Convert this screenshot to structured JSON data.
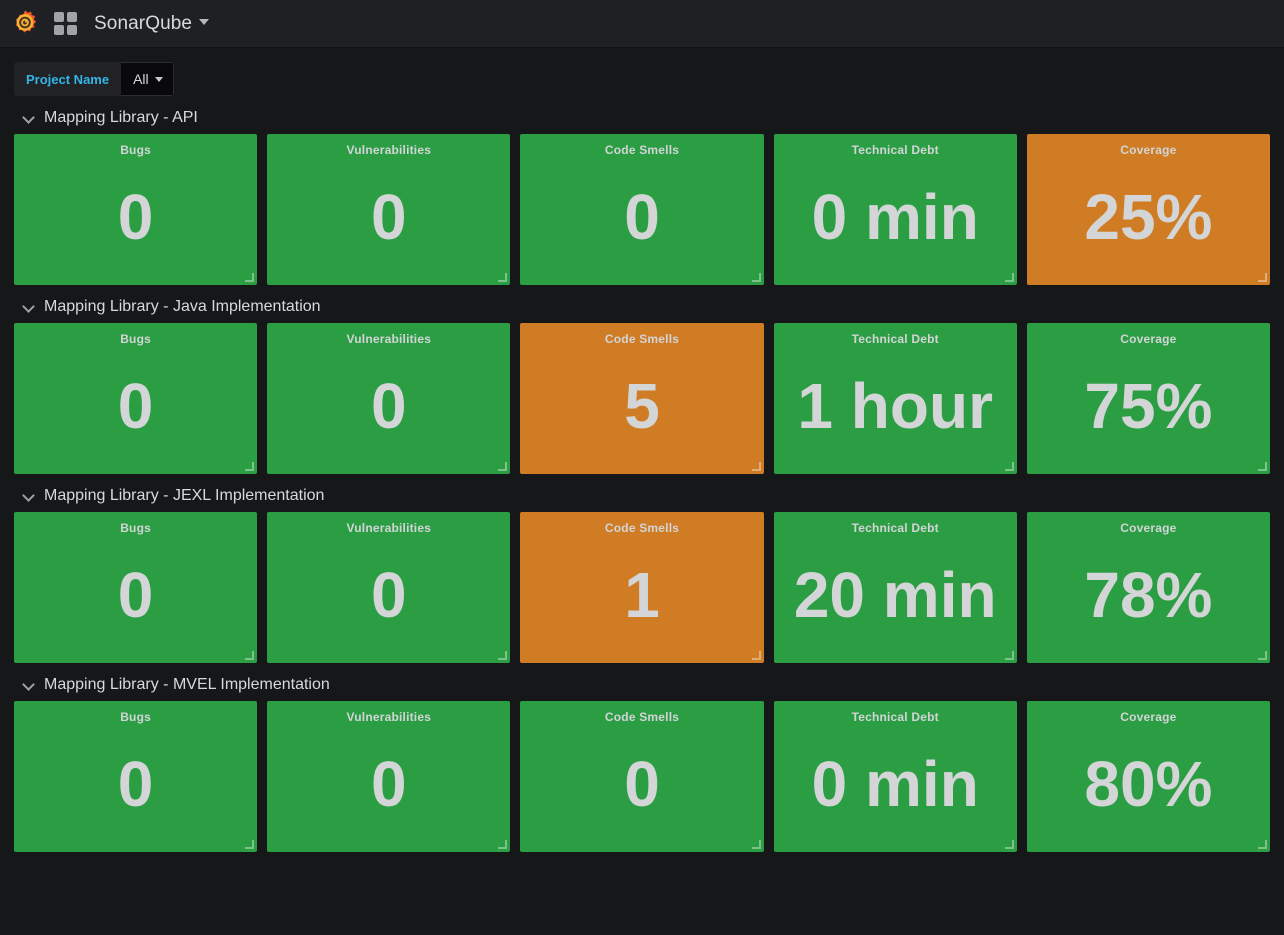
{
  "navbar": {
    "logo_icon": "grafana-logo-icon",
    "dashboard_icon": "dashboard-grid-icon",
    "title": "SonarQube",
    "title_caret_icon": "chevron-down-icon"
  },
  "submenu": {
    "variable": {
      "label": "Project Name",
      "value": "All",
      "caret_icon": "chevron-down-icon"
    }
  },
  "colors": {
    "green": "#2b9e44",
    "orange": "#cf7c24",
    "accent": "#33b5e5",
    "background": "#161719"
  },
  "panel_titles": {
    "bugs": "Bugs",
    "vulnerabilities": "Vulnerabilities",
    "code_smells": "Code Smells",
    "technical_debt": "Technical Debt",
    "coverage": "Coverage"
  },
  "rows": [
    {
      "title": "Mapping Library - API",
      "chevron_icon": "chevron-down-icon",
      "panels": [
        {
          "title": "Bugs",
          "value": "0",
          "color": "green"
        },
        {
          "title": "Vulnerabilities",
          "value": "0",
          "color": "green"
        },
        {
          "title": "Code Smells",
          "value": "0",
          "color": "green"
        },
        {
          "title": "Technical Debt",
          "value": "0 min",
          "color": "green"
        },
        {
          "title": "Coverage",
          "value": "25%",
          "color": "orange"
        }
      ]
    },
    {
      "title": "Mapping Library - Java Implementation",
      "chevron_icon": "chevron-down-icon",
      "panels": [
        {
          "title": "Bugs",
          "value": "0",
          "color": "green"
        },
        {
          "title": "Vulnerabilities",
          "value": "0",
          "color": "green"
        },
        {
          "title": "Code Smells",
          "value": "5",
          "color": "orange"
        },
        {
          "title": "Technical Debt",
          "value": "1 hour",
          "color": "green"
        },
        {
          "title": "Coverage",
          "value": "75%",
          "color": "green"
        }
      ]
    },
    {
      "title": "Mapping Library - JEXL Implementation",
      "chevron_icon": "chevron-down-icon",
      "panels": [
        {
          "title": "Bugs",
          "value": "0",
          "color": "green"
        },
        {
          "title": "Vulnerabilities",
          "value": "0",
          "color": "green"
        },
        {
          "title": "Code Smells",
          "value": "1",
          "color": "orange"
        },
        {
          "title": "Technical Debt",
          "value": "20 min",
          "color": "green"
        },
        {
          "title": "Coverage",
          "value": "78%",
          "color": "green"
        }
      ]
    },
    {
      "title": "Mapping Library - MVEL Implementation",
      "chevron_icon": "chevron-down-icon",
      "panels": [
        {
          "title": "Bugs",
          "value": "0",
          "color": "green"
        },
        {
          "title": "Vulnerabilities",
          "value": "0",
          "color": "green"
        },
        {
          "title": "Code Smells",
          "value": "0",
          "color": "green"
        },
        {
          "title": "Technical Debt",
          "value": "0 min",
          "color": "green"
        },
        {
          "title": "Coverage",
          "value": "80%",
          "color": "green"
        }
      ]
    }
  ]
}
